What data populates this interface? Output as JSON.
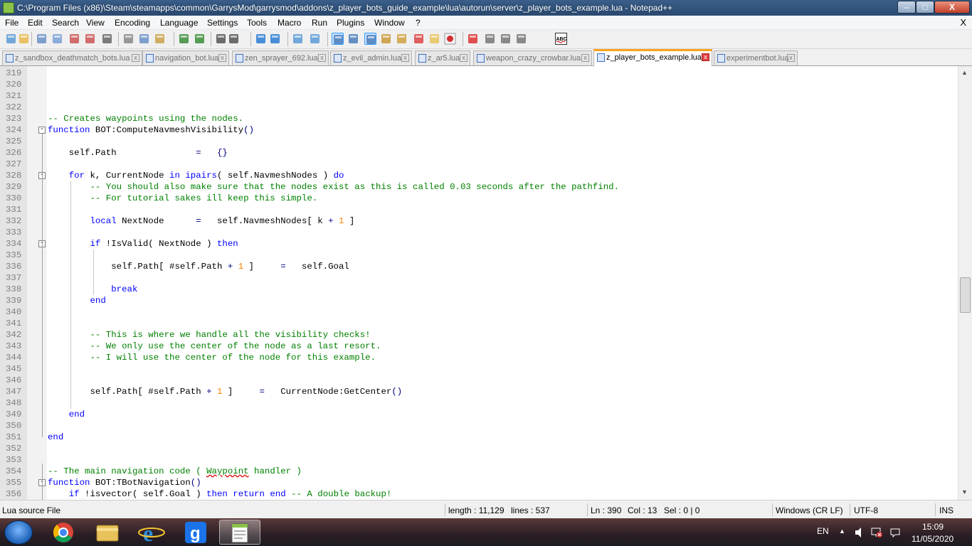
{
  "window": {
    "title": "C:\\Program Files (x86)\\Steam\\steamapps\\common\\GarrysMod\\garrysmod\\addons\\z_player_bots_guide_example\\lua\\autorun\\server\\z_player_bots_example.lua - Notepad++",
    "minimize_glyph": "–",
    "maximize_glyph": "□",
    "close_glyph": "X"
  },
  "menu": {
    "items": [
      "File",
      "Edit",
      "Search",
      "View",
      "Encoding",
      "Language",
      "Settings",
      "Tools",
      "Macro",
      "Run",
      "Plugins",
      "Window",
      "?"
    ],
    "doc_close": "X"
  },
  "toolbar": {
    "icons": [
      "new-file-icon",
      "open-file-icon",
      "save-icon",
      "save-all-icon",
      "close-icon",
      "close-all-icon",
      "print-icon",
      "cut-icon",
      "copy-icon",
      "paste-icon",
      "undo-icon",
      "redo-icon",
      "find-icon",
      "replace-icon",
      "zoom-in-icon",
      "zoom-out-icon",
      "sync-vertical-icon",
      "sync-horizontal-icon",
      "word-wrap-icon",
      "show-all-chars-icon",
      "indent-guide-icon",
      "doc-map-icon",
      "function-list-icon",
      "folder-workspace-icon",
      "monitoring-icon",
      "record-macro-icon",
      "stop-record-icon",
      "play-macro-icon",
      "run-macro-multiple-icon",
      "save-macro-icon",
      "spell-check-icon"
    ],
    "spell_label": "ABC"
  },
  "tabs": [
    {
      "label": "z_sandbox_deathmatch_bots.lua",
      "active": false
    },
    {
      "label": "navigation_bot.lua",
      "active": false
    },
    {
      "label": "zen_sprayer_692.lua",
      "active": false
    },
    {
      "label": "z_evil_admin.lua",
      "active": false
    },
    {
      "label": "z_ar5.lua",
      "active": false
    },
    {
      "label": "weapon_crazy_crowbar.lua",
      "active": false
    },
    {
      "label": "z_player_bots_example.lua",
      "active": true
    },
    {
      "label": "experimentbot.lua",
      "active": false
    }
  ],
  "tab_close_glyph": "x",
  "editor": {
    "lines": [
      {
        "n": "319",
        "segs": []
      },
      {
        "n": "320",
        "segs": []
      },
      {
        "n": "321",
        "segs": []
      },
      {
        "n": "322",
        "segs": []
      },
      {
        "n": "323",
        "segs": [
          {
            "t": "-- Creates waypoints using the nodes.",
            "c": "cm"
          }
        ]
      },
      {
        "n": "324",
        "fold": "-",
        "segs": [
          {
            "t": "function",
            "c": "kw"
          },
          {
            "t": " BOT:ComputeNavmeshVisibility",
            "c": ""
          },
          {
            "t": "()",
            "c": "op"
          }
        ]
      },
      {
        "n": "325",
        "segs": []
      },
      {
        "n": "326",
        "segs": [
          {
            "t": "    self.Path               ",
            "c": ""
          },
          {
            "t": "=",
            "c": "op"
          },
          {
            "t": "   ",
            "c": ""
          },
          {
            "t": "{}",
            "c": "op"
          }
        ]
      },
      {
        "n": "327",
        "segs": []
      },
      {
        "n": "328",
        "fold": "-",
        "segs": [
          {
            "t": "    ",
            "c": ""
          },
          {
            "t": "for",
            "c": "kw"
          },
          {
            "t": " k, CurrentNode ",
            "c": ""
          },
          {
            "t": "in",
            "c": "kw"
          },
          {
            "t": " ",
            "c": ""
          },
          {
            "t": "ipairs",
            "c": "kw"
          },
          {
            "t": "( self.NavmeshNodes ) ",
            "c": ""
          },
          {
            "t": "do",
            "c": "kw"
          }
        ]
      },
      {
        "n": "329",
        "segs": [
          {
            "t": "        -- You should also make sure that the nodes exist as this is called 0.03 seconds after the pathfind.",
            "c": "cm"
          }
        ]
      },
      {
        "n": "330",
        "segs": [
          {
            "t": "        -- For tutorial sakes ill keep this simple.",
            "c": "cm"
          }
        ]
      },
      {
        "n": "331",
        "segs": []
      },
      {
        "n": "332",
        "segs": [
          {
            "t": "        ",
            "c": ""
          },
          {
            "t": "local",
            "c": "kw"
          },
          {
            "t": " NextNode      ",
            "c": ""
          },
          {
            "t": "=",
            "c": "op"
          },
          {
            "t": "   self.NavmeshNodes[ k ",
            "c": ""
          },
          {
            "t": "+",
            "c": "op"
          },
          {
            "t": " ",
            "c": ""
          },
          {
            "t": "1",
            "c": "num"
          },
          {
            "t": " ]",
            "c": ""
          }
        ]
      },
      {
        "n": "333",
        "segs": []
      },
      {
        "n": "334",
        "fold": "-",
        "segs": [
          {
            "t": "        ",
            "c": ""
          },
          {
            "t": "if",
            "c": "kw"
          },
          {
            "t": " !IsValid( NextNode ) ",
            "c": ""
          },
          {
            "t": "then",
            "c": "kw"
          }
        ]
      },
      {
        "n": "335",
        "segs": []
      },
      {
        "n": "336",
        "segs": [
          {
            "t": "            self.Path[ #self.Path ",
            "c": ""
          },
          {
            "t": "+",
            "c": "op"
          },
          {
            "t": " ",
            "c": ""
          },
          {
            "t": "1",
            "c": "num"
          },
          {
            "t": " ]     ",
            "c": ""
          },
          {
            "t": "=",
            "c": "op"
          },
          {
            "t": "   self.Goal",
            "c": ""
          }
        ]
      },
      {
        "n": "337",
        "segs": []
      },
      {
        "n": "338",
        "segs": [
          {
            "t": "            ",
            "c": ""
          },
          {
            "t": "break",
            "c": "kw"
          }
        ]
      },
      {
        "n": "339",
        "segs": [
          {
            "t": "        ",
            "c": ""
          },
          {
            "t": "end",
            "c": "kw"
          }
        ]
      },
      {
        "n": "340",
        "segs": []
      },
      {
        "n": "341",
        "segs": []
      },
      {
        "n": "342",
        "segs": [
          {
            "t": "        -- This is where we handle all the visibility checks!",
            "c": "cm"
          }
        ]
      },
      {
        "n": "343",
        "segs": [
          {
            "t": "        -- We only use the center of the node as a last resort.",
            "c": "cm"
          }
        ]
      },
      {
        "n": "344",
        "segs": [
          {
            "t": "        -- I will use the center of the node for this example.",
            "c": "cm"
          }
        ]
      },
      {
        "n": "345",
        "segs": []
      },
      {
        "n": "346",
        "segs": []
      },
      {
        "n": "347",
        "segs": [
          {
            "t": "        self.Path[ #self.Path ",
            "c": ""
          },
          {
            "t": "+",
            "c": "op"
          },
          {
            "t": " ",
            "c": ""
          },
          {
            "t": "1",
            "c": "num"
          },
          {
            "t": " ]     ",
            "c": ""
          },
          {
            "t": "=",
            "c": "op"
          },
          {
            "t": "   CurrentNode:GetCenter",
            "c": ""
          },
          {
            "t": "()",
            "c": "op"
          }
        ]
      },
      {
        "n": "348",
        "segs": []
      },
      {
        "n": "349",
        "segs": [
          {
            "t": "    ",
            "c": ""
          },
          {
            "t": "end",
            "c": "kw"
          }
        ]
      },
      {
        "n": "350",
        "segs": []
      },
      {
        "n": "351",
        "segs": [
          {
            "t": "end",
            "c": "kw"
          }
        ]
      },
      {
        "n": "352",
        "segs": []
      },
      {
        "n": "353",
        "segs": []
      },
      {
        "n": "354",
        "segs": [
          {
            "t": "-- The main navigation code ( ",
            "c": "cm"
          },
          {
            "t": "Waypoint",
            "c": "cm sq"
          },
          {
            "t": " handler )",
            "c": "cm"
          }
        ]
      },
      {
        "n": "355",
        "fold": "-",
        "segs": [
          {
            "t": "function",
            "c": "kw"
          },
          {
            "t": " BOT:TBotNavigation",
            "c": ""
          },
          {
            "t": "()",
            "c": "op"
          }
        ]
      },
      {
        "n": "356",
        "segs": [
          {
            "t": "    ",
            "c": ""
          },
          {
            "t": "if",
            "c": "kw"
          },
          {
            "t": " !isvector( self.Goal ) ",
            "c": ""
          },
          {
            "t": "then",
            "c": "kw"
          },
          {
            "t": " ",
            "c": ""
          },
          {
            "t": "return",
            "c": "kw"
          },
          {
            "t": " ",
            "c": ""
          },
          {
            "t": "end",
            "c": "kw"
          },
          {
            "t": " -- A double backup!",
            "c": "cm"
          }
        ]
      }
    ]
  },
  "scrollbar": {
    "up": "▲",
    "down": "▼"
  },
  "status": {
    "file_type": "Lua source File",
    "length": "length : 11,129",
    "lines": "lines : 537",
    "ln": "Ln : 390",
    "col": "Col : 13",
    "sel": "Sel : 0 | 0",
    "eol": "Windows (CR LF)",
    "encoding": "UTF-8",
    "mode": "INS"
  },
  "taskbar": {
    "apps": [
      "chrome-icon",
      "file-explorer-icon",
      "internet-explorer-icon",
      "garrys-mod-icon",
      "notepad-plus-plus-icon"
    ],
    "gmod_letter": "g",
    "ie_letter": "e",
    "lang": "EN",
    "tray_arrow": "▲",
    "time": "15:09",
    "date": "11/05/2020"
  },
  "colors": {
    "comment": "#008000",
    "keyword": "#0000ff",
    "number": "#ff8000",
    "active_tab_accent": "#fba31c"
  }
}
